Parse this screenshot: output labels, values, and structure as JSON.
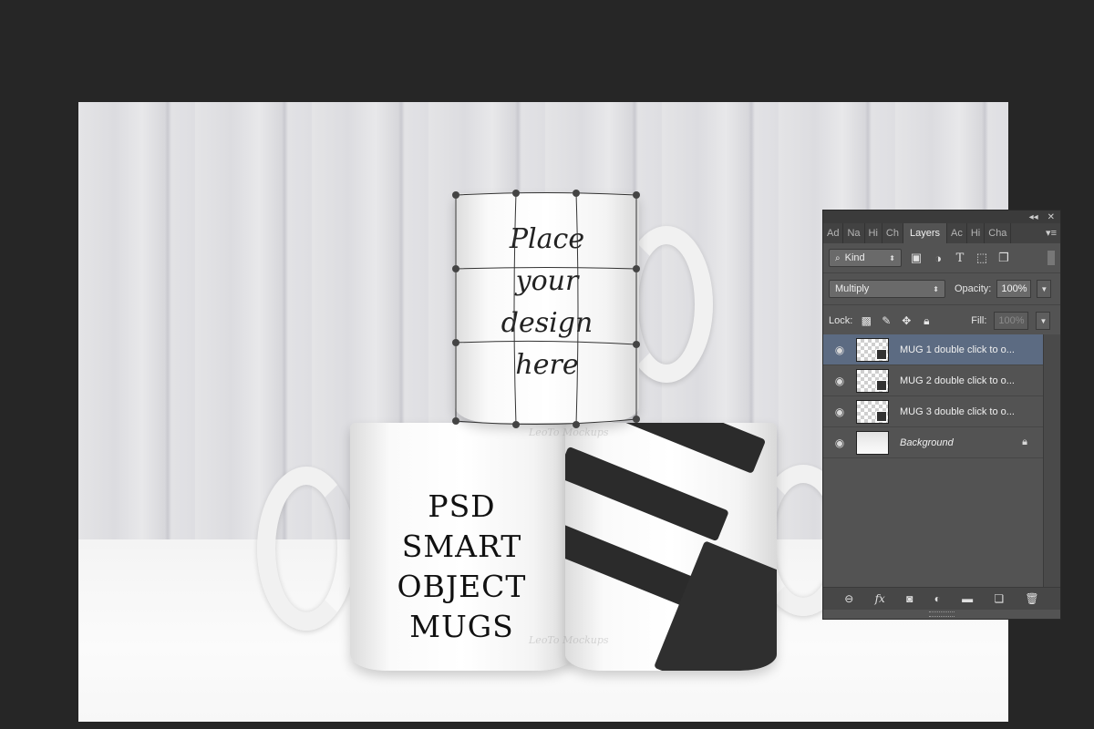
{
  "canvas": {
    "mug1_text": [
      "Place",
      "your",
      "design",
      "here"
    ],
    "mug2_text": [
      "PSD",
      "SMART",
      "OBJECT",
      "MUGS"
    ],
    "watermark": "LeoTo Mockups"
  },
  "panel": {
    "collapse_glyph": "◂◂",
    "close_glyph": "✕",
    "tabs": [
      "Ad",
      "Na",
      "Hi",
      "Ch",
      "Layers",
      "Ac",
      "Hi",
      "Cha"
    ],
    "active_tab": "Layers",
    "menu_glyph": "▾≡",
    "filter_kind": "Kind",
    "blend_mode": "Multiply",
    "opacity_label": "Opacity:",
    "opacity_value": "100%",
    "lock_label": "Lock:",
    "fill_label": "Fill:",
    "fill_value": "100%",
    "layers": [
      {
        "name": "MUG 1 double click to o...",
        "type": "smart",
        "selected": true
      },
      {
        "name": "MUG 2 double click to o...",
        "type": "smart",
        "selected": false
      },
      {
        "name": "MUG 3 double click to o...",
        "type": "smart",
        "selected": false
      },
      {
        "name": "Background",
        "type": "background",
        "selected": false
      }
    ],
    "footer_icons": [
      "link-icon",
      "fx-icon",
      "mask-icon",
      "adjustment-icon",
      "folder-icon",
      "new-layer-icon",
      "trash-icon"
    ]
  },
  "colors": {
    "app_bg": "#262626",
    "panel_bg": "#535353",
    "selected_layer": "#5c6b82"
  }
}
